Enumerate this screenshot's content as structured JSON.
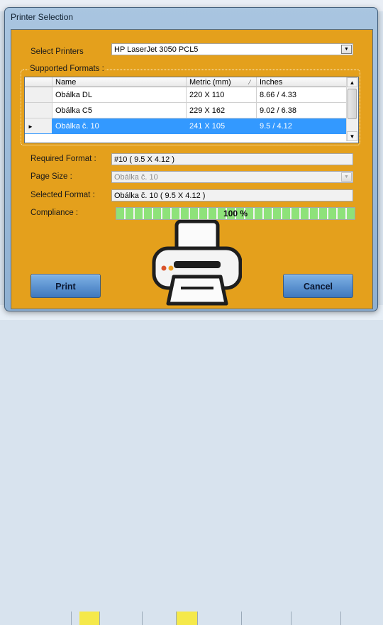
{
  "window": {
    "title": "Printer Selection"
  },
  "printers": {
    "label": "Select Printers",
    "value": "HP LaserJet 3050 PCL5"
  },
  "formats": {
    "group_title": "Supported Formats :",
    "columns": [
      "Name",
      "Metric (mm)",
      "Inches"
    ],
    "rows": [
      {
        "name": "Obálka DL",
        "metric": "220 X 110",
        "inches": "8.66 / 4.33",
        "selected": false
      },
      {
        "name": "Obálka C5",
        "metric": "229 X 162",
        "inches": "9.02 / 6.38",
        "selected": false
      },
      {
        "name": "Obálka č. 10",
        "metric": "241 X 105",
        "inches": "9.5 / 4.12",
        "selected": true
      }
    ]
  },
  "required": {
    "label": "Required Format :",
    "value": "#10 ( 9.5 X 4.12 )"
  },
  "page_size": {
    "label": "Page Size :",
    "value": "Obálka č. 10"
  },
  "selected_format": {
    "label": "Selected Format :",
    "value": "Obálka č. 10 ( 9.5 X 4.12 )"
  },
  "compliance": {
    "label": "Compliance :",
    "value_text": "100 %",
    "fraction": 1.0
  },
  "buttons": {
    "print": "Print",
    "cancel": "Cancel"
  },
  "colors": {
    "client_bg": "#e4a01c",
    "selection": "#3399ff",
    "progress": "#8ee27a",
    "button": "#4f8ac9"
  }
}
